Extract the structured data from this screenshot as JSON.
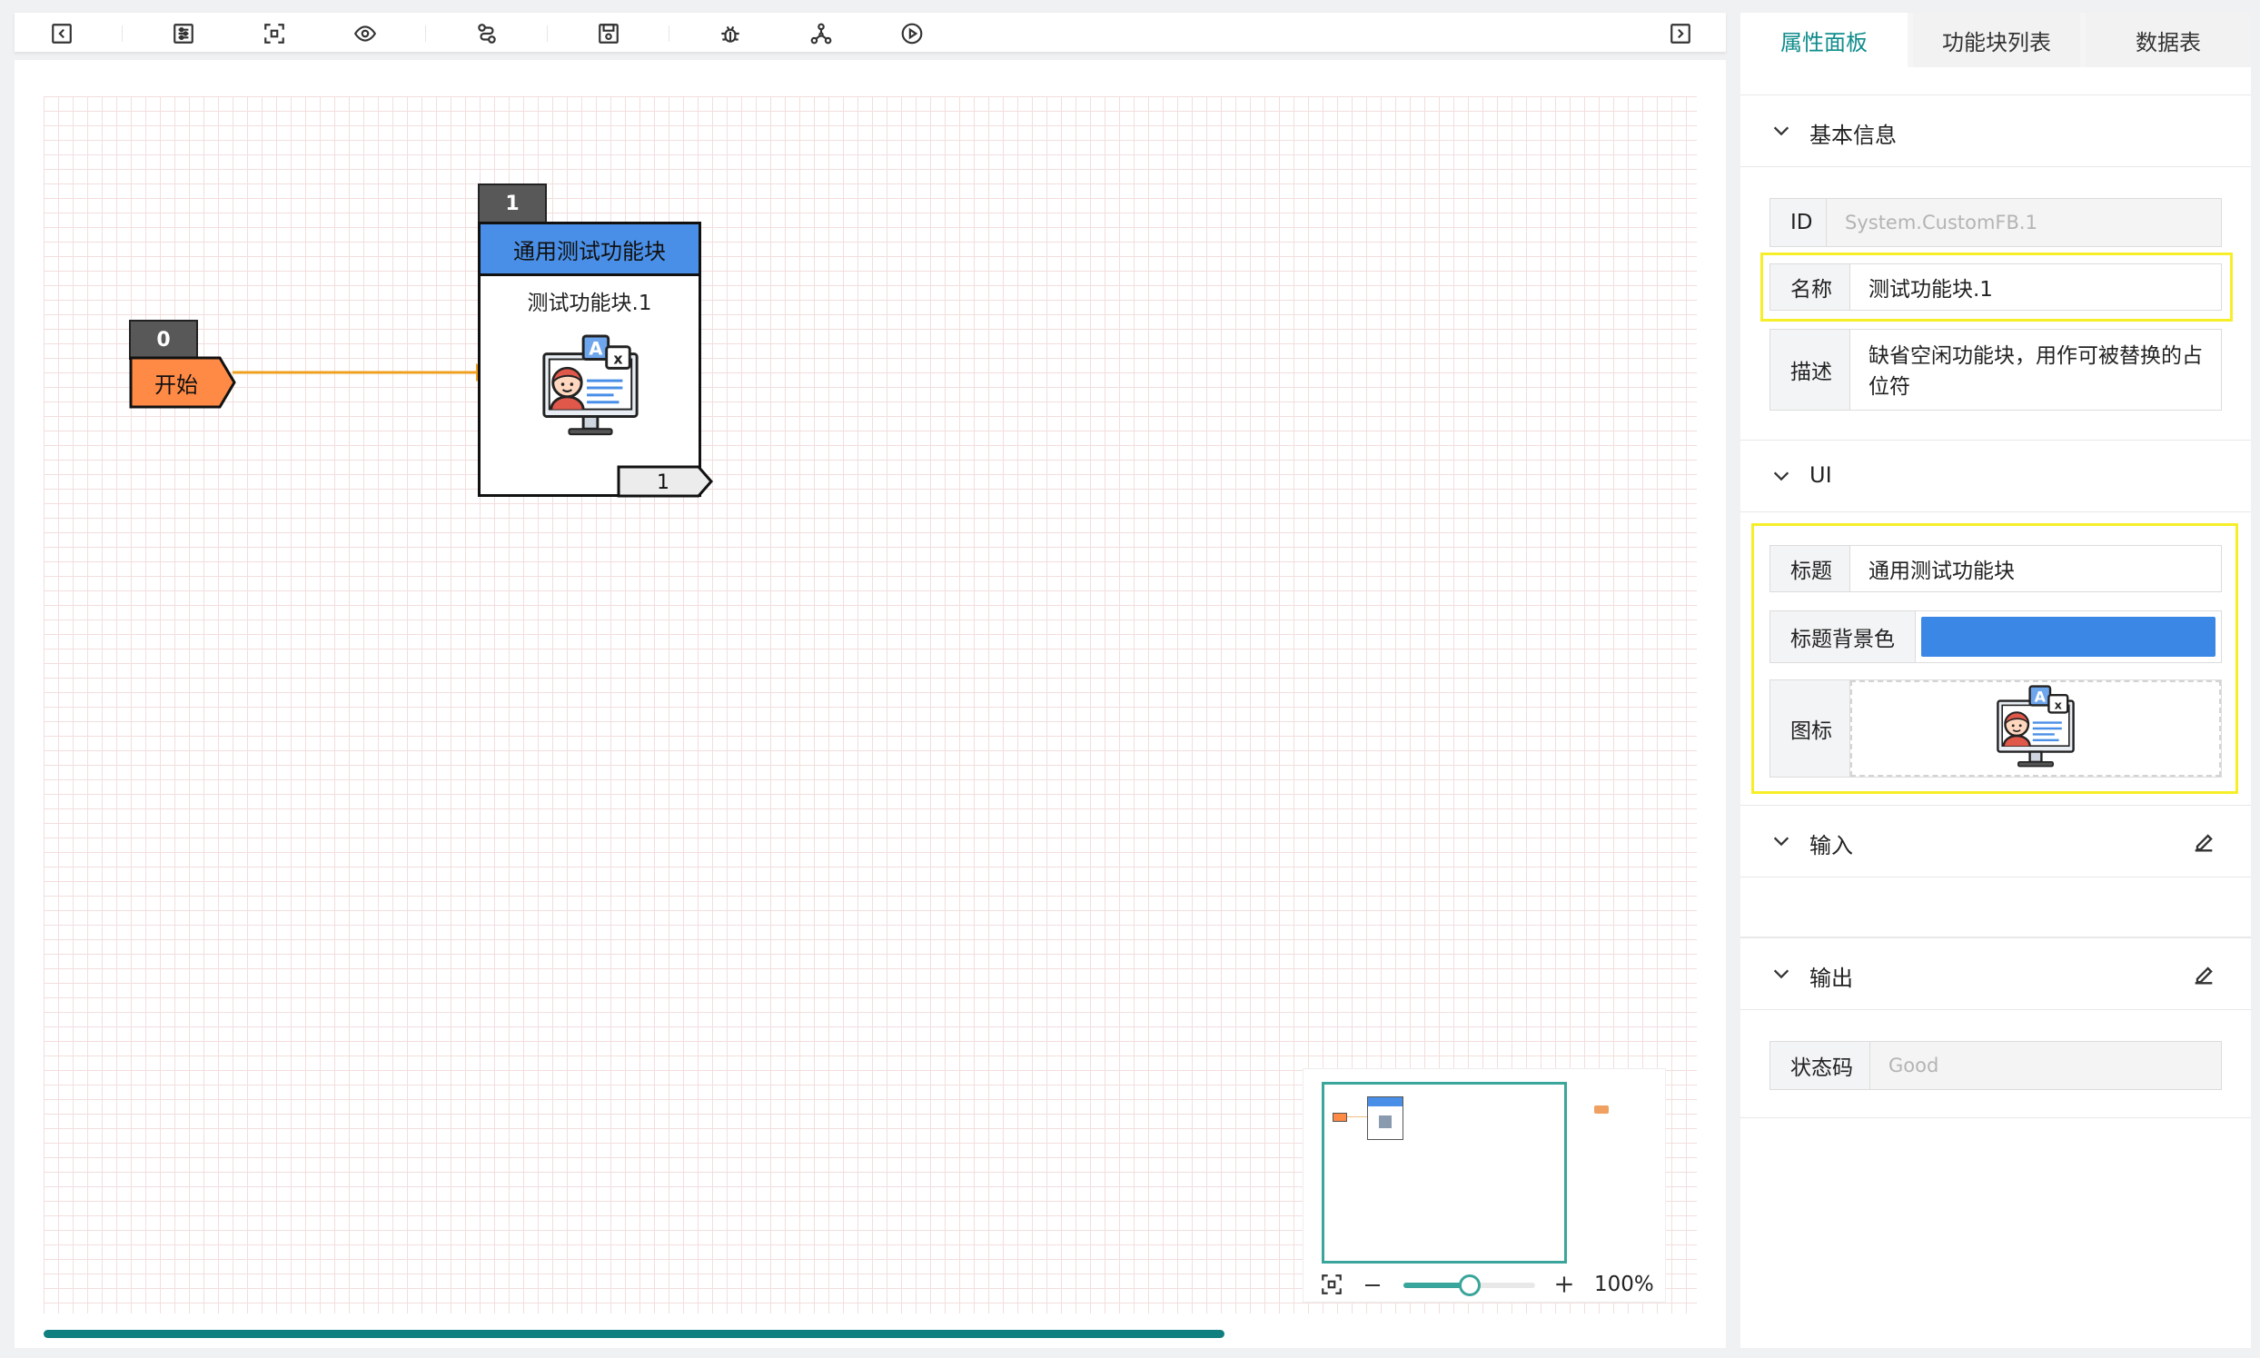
{
  "toolbar": {
    "buttons": [
      {
        "name": "collapse-left-icon"
      },
      {
        "name": "settings-sliders-icon"
      },
      {
        "name": "fit-view-icon"
      },
      {
        "name": "eye-icon"
      },
      {
        "name": "route-icon"
      },
      {
        "name": "save-icon"
      },
      {
        "name": "bug-icon"
      },
      {
        "name": "network-icon"
      },
      {
        "name": "play-icon"
      }
    ],
    "right_button": "expand-right-icon"
  },
  "canvas": {
    "start_node": {
      "id": "0",
      "label": "开始",
      "color": "#ff8a45"
    },
    "fb_node": {
      "id": "1",
      "header": "通用测试功能块",
      "name": "测试功能块.1",
      "output_port": "1",
      "header_color": "#4a8fe7"
    },
    "edge_color": "#f0a020",
    "zoom": "100%",
    "zoom_level": 0.5
  },
  "panel": {
    "tabs": [
      "属性面板",
      "功能块列表",
      "数据表"
    ],
    "active_tab": 0,
    "sections": {
      "basic": {
        "title": "基本信息"
      },
      "ui": {
        "title": "UI"
      },
      "input": {
        "title": "输入"
      },
      "output": {
        "title": "输出"
      }
    },
    "fields": {
      "id": {
        "label": "ID",
        "value": "System.CustomFB.1"
      },
      "name": {
        "label": "名称",
        "value": "测试功能块.1"
      },
      "desc": {
        "label": "描述",
        "value": "缺省空闲功能块，用作可被替换的占位符"
      },
      "title": {
        "label": "标题",
        "value": "通用测试功能块"
      },
      "title_bg": {
        "label": "标题背景色",
        "color": "#3b87e6"
      },
      "icon": {
        "label": "图标"
      },
      "status": {
        "label": "状态码",
        "value": "Good"
      }
    },
    "accent": "#0f8c8c"
  }
}
